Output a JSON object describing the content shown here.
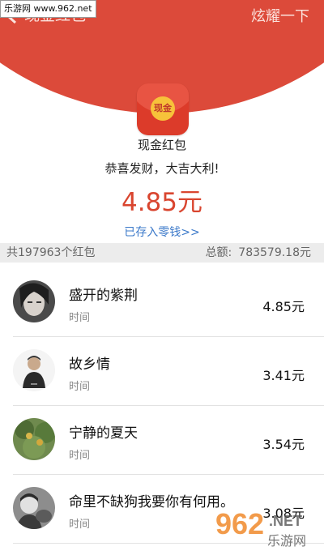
{
  "watermark": {
    "top_left": "乐游网 www.962.net",
    "bottom_right_logo": "962",
    "bottom_right_sub": ".NET",
    "bottom_right_cn": "乐游网"
  },
  "nav": {
    "back_icon": "chevron-left-icon",
    "title": "现金红包",
    "action": "炫耀一下"
  },
  "colors": {
    "header_red": "#dc4a3a",
    "amount_red": "#d9452f",
    "link_blue": "#3a78c9"
  },
  "red_packet": {
    "icon_label": "现金",
    "title": "现金红包",
    "greeting": "恭喜发财，大吉大利!",
    "amount": "4.85元",
    "stored_link": "已存入零钱>>"
  },
  "summary": {
    "count_text": "共197963个红包",
    "total_label": "总额:",
    "total_value": "783579.18元"
  },
  "records": [
    {
      "name": "盛开的紫荆",
      "time": "时间",
      "amount": "4.85元"
    },
    {
      "name": "故乡情",
      "time": "时间",
      "amount": "3.41元"
    },
    {
      "name": "宁静的夏天",
      "time": "时间",
      "amount": "3.54元"
    },
    {
      "name": "命里不缺狗我要你有何用。",
      "time": "时间",
      "amount": "3.08元"
    }
  ]
}
